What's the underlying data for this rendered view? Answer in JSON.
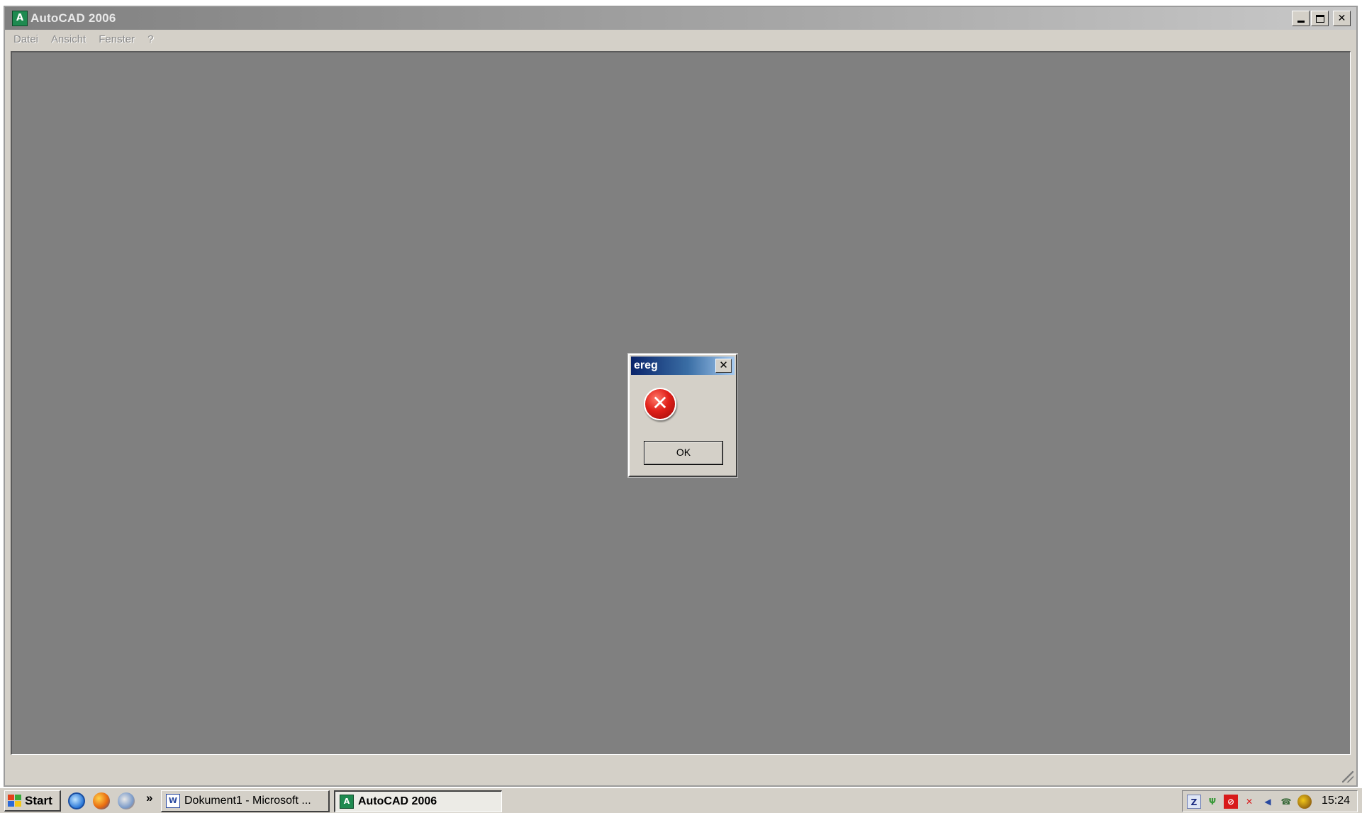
{
  "window": {
    "title": "AutoCAD 2006",
    "icon": "autocad-icon"
  },
  "menubar": {
    "items": [
      "Datei",
      "Ansicht",
      "Fenster",
      "?"
    ]
  },
  "dialog": {
    "title": "ereg",
    "icon": "error-icon",
    "ok_label": "OK"
  },
  "taskbar": {
    "start_label": "Start",
    "quicklaunch": [
      "internet-explorer-icon",
      "firefox-icon",
      "browser-icon"
    ],
    "quicklaunch_more": "»",
    "tasks": [
      {
        "label": "Dokument1 - Microsoft ...",
        "icon": "word-icon",
        "active": false
      },
      {
        "label": "AutoCAD 2006",
        "icon": "autocad-icon",
        "active": true
      }
    ],
    "tray_icons": [
      "zonealarm-icon",
      "network-icon",
      "antivirus-icon",
      "network-disconnected-icon",
      "speaker-icon",
      "phone-icon",
      "security-icon"
    ],
    "clock": "15:24"
  },
  "colors": {
    "workspace": "#808080",
    "chrome": "#d4d0c8",
    "dialog_title": "#0a246a",
    "error_red": "#e0201a"
  }
}
